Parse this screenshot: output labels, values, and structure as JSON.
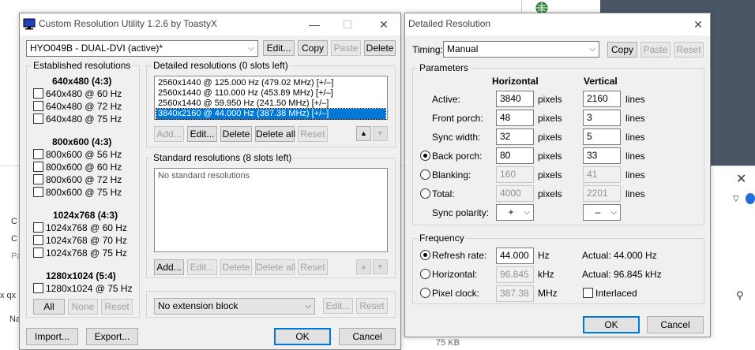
{
  "background": {
    "status_size": "75 KB",
    "frag_qx": "x qx",
    "frag_n": "Na",
    "frag_c1": "C",
    "frag_c2": "C",
    "frag_p": "Pa"
  },
  "main": {
    "title": "Custom Resolution Utility 1.2.6 by ToastyX",
    "monitor_select": "HYO049B - DUAL-DVI (active)*",
    "buttons": {
      "edit": "Edit...",
      "copy": "Copy",
      "paste": "Paste",
      "delete": "Delete"
    },
    "established": {
      "label": "Established resolutions",
      "groups": [
        {
          "heading": "640x480 (4:3)",
          "items": [
            "640x480 @ 60 Hz",
            "640x480 @ 72 Hz",
            "640x480 @ 75 Hz"
          ]
        },
        {
          "heading": "800x600 (4:3)",
          "items": [
            "800x600 @ 56 Hz",
            "800x600 @ 60 Hz",
            "800x600 @ 72 Hz",
            "800x600 @ 75 Hz"
          ]
        },
        {
          "heading": "1024x768 (4:3)",
          "items": [
            "1024x768 @ 60 Hz",
            "1024x768 @ 70 Hz",
            "1024x768 @ 75 Hz"
          ]
        },
        {
          "heading": "1280x1024 (5:4)",
          "items": [
            "1280x1024 @ 75 Hz"
          ]
        }
      ],
      "all": "All",
      "none": "None",
      "reset": "Reset"
    },
    "detailed": {
      "label": "Detailed resolutions (0 slots left)",
      "items": [
        "2560x1440 @ 125.000 Hz (479.02 MHz) [+/–]",
        "2560x1440 @ 110.000 Hz (453.89 MHz) [+/–]",
        "2560x1440 @ 59.950 Hz (241.50 MHz) [+/–]",
        "3840x2160 @ 44.000 Hz (387.38 MHz) [+/–]"
      ],
      "selected_index": 3,
      "add": "Add...",
      "edit": "Edit...",
      "delete": "Delete",
      "delete_all": "Delete all",
      "reset": "Reset"
    },
    "standard": {
      "label": "Standard resolutions (8 slots left)",
      "empty_text": "No standard resolutions",
      "add": "Add...",
      "edit": "Edit...",
      "delete": "Delete",
      "delete_all": "Delete all",
      "reset": "Reset"
    },
    "extension_select": "No extension block",
    "ext_edit": "Edit...",
    "ext_reset": "Reset",
    "import": "Import...",
    "export": "Export...",
    "ok": "OK",
    "cancel": "Cancel"
  },
  "detail": {
    "title": "Detailed Resolution",
    "timing_label": "Timing:",
    "timing_value": "Manual",
    "copy": "Copy",
    "paste": "Paste",
    "reset": "Reset",
    "parameters": {
      "label": "Parameters",
      "col_h": "Horizontal",
      "col_v": "Vertical",
      "rows": [
        {
          "label": "Active:",
          "h": "3840",
          "h_unit": "pixels",
          "v": "2160",
          "v_unit": "lines"
        },
        {
          "label": "Front porch:",
          "h": "48",
          "h_unit": "pixels",
          "v": "3",
          "v_unit": "lines"
        },
        {
          "label": "Sync width:",
          "h": "32",
          "h_unit": "pixels",
          "v": "5",
          "v_unit": "lines"
        },
        {
          "label": "Back porch:",
          "h": "80",
          "h_unit": "pixels",
          "v": "33",
          "v_unit": "lines"
        },
        {
          "label": "Blanking:",
          "h": "160",
          "h_unit": "pixels",
          "v": "41",
          "v_unit": "lines"
        },
        {
          "label": "Total:",
          "h": "4000",
          "h_unit": "pixels",
          "v": "2201",
          "v_unit": "lines"
        }
      ],
      "sync_polarity_label": "Sync polarity:",
      "sync_h": "+",
      "sync_v": "–"
    },
    "frequency": {
      "label": "Frequency",
      "refresh_label": "Refresh rate:",
      "refresh_value": "44.000",
      "refresh_unit": "Hz",
      "refresh_actual": "Actual: 44.000 Hz",
      "horizontal_label": "Horizontal:",
      "horizontal_value": "96.845",
      "horizontal_unit": "kHz",
      "horizontal_actual": "Actual: 96.845 kHz",
      "pixel_label": "Pixel clock:",
      "pixel_value": "387.38",
      "pixel_unit": "MHz",
      "interlaced": "Interlaced"
    },
    "ok": "OK",
    "cancel": "Cancel"
  }
}
